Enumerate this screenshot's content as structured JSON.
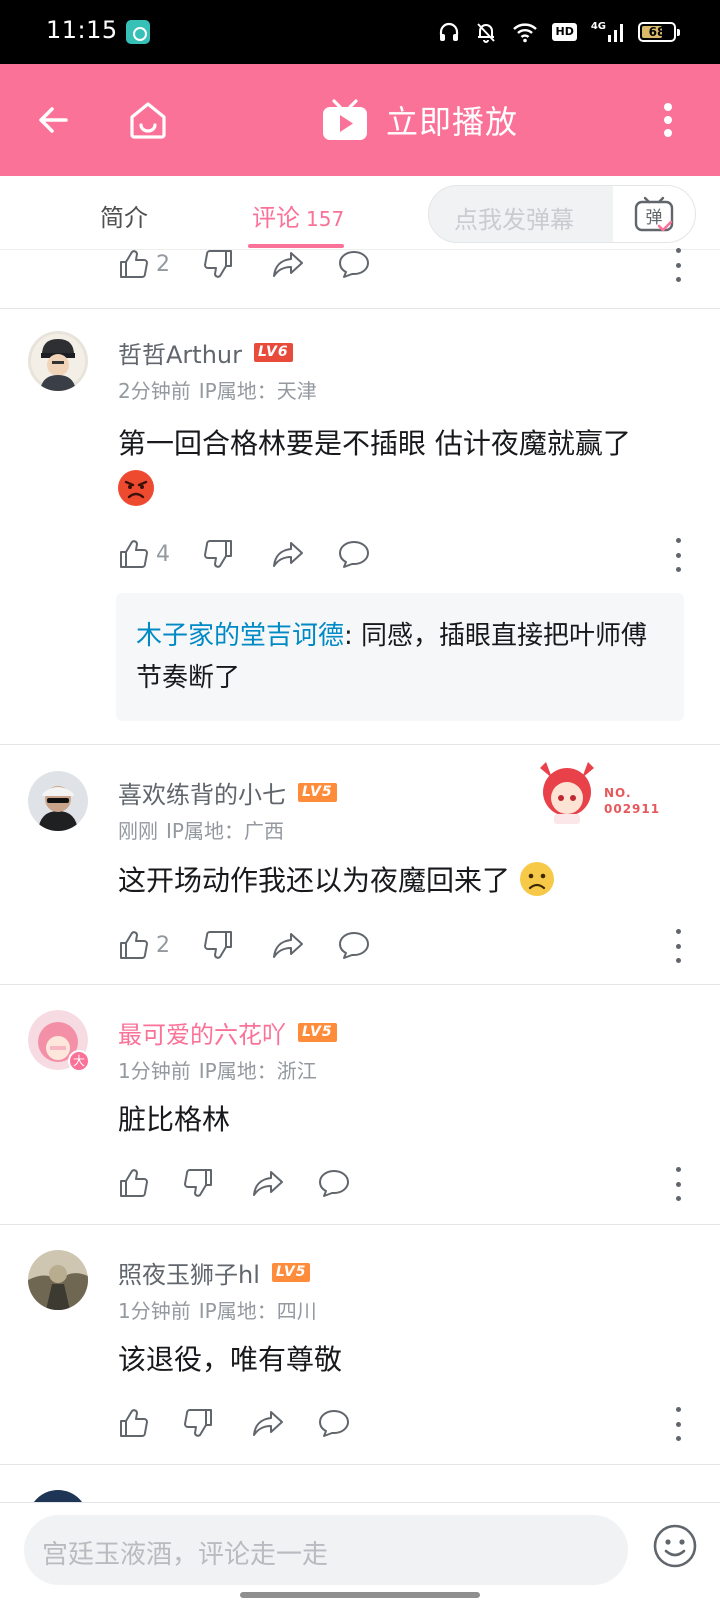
{
  "status_bar": {
    "time": "11:15",
    "hd": "HD",
    "network": "4G",
    "battery": "68",
    "battery_level": 0.68
  },
  "header": {
    "back_icon": "arrow-left-icon",
    "home_icon": "home-face-icon",
    "play_label": "立即播放",
    "menu_icon": "more-vertical-icon"
  },
  "tabs": {
    "intro": "简介",
    "comments": "评论",
    "comments_count": "157",
    "danmaku_placeholder": "点我发弹幕",
    "danmaku_icon_label": "弹"
  },
  "top_partial": {
    "likes": "2"
  },
  "comments": [
    {
      "user": "哲哲Arthur",
      "level": "LV6",
      "level_color": "#e84b3c",
      "time": "2分钟前",
      "ip": "IP属地：天津",
      "text": "第一回合格林要是不插眼 估计夜魔就赢了",
      "emoji": "angry-face",
      "likes": "4",
      "reply": {
        "user": "木子家的堂吉诃德",
        "text": ": 同感，插眼直接把叶师傅节奏断了"
      }
    },
    {
      "user": "喜欢练背的小七",
      "level": "LV5",
      "level_color": "#ff8c3b",
      "time": "刚刚",
      "ip": "IP属地：广西",
      "text": "这开场动作我还以为夜魔回来了",
      "emoji": "slightly-frowning-face",
      "likes": "2",
      "decoration_line1": "NO.",
      "decoration_line2": "002911"
    },
    {
      "user": "最可爱的六花吖",
      "level": "LV5",
      "level_color": "#ff8c3b",
      "time": "1分钟前",
      "ip": "IP属地：浙江",
      "text": "脏比格林",
      "avatar_badge": "大"
    },
    {
      "user": "照夜玉狮子hl",
      "level": "LV5",
      "level_color": "#ff8c3b",
      "time": "1分钟前",
      "ip": "IP属地：四川",
      "text": "该退役，唯有尊敬"
    }
  ],
  "bottom": {
    "input_placeholder": "宫廷玉液酒，评论走一走",
    "emoji_icon": "emoji-face-icon"
  },
  "colors": {
    "brand_pink": "#fb7299",
    "link_blue": "#008ac5",
    "muted": "#9499a0"
  }
}
